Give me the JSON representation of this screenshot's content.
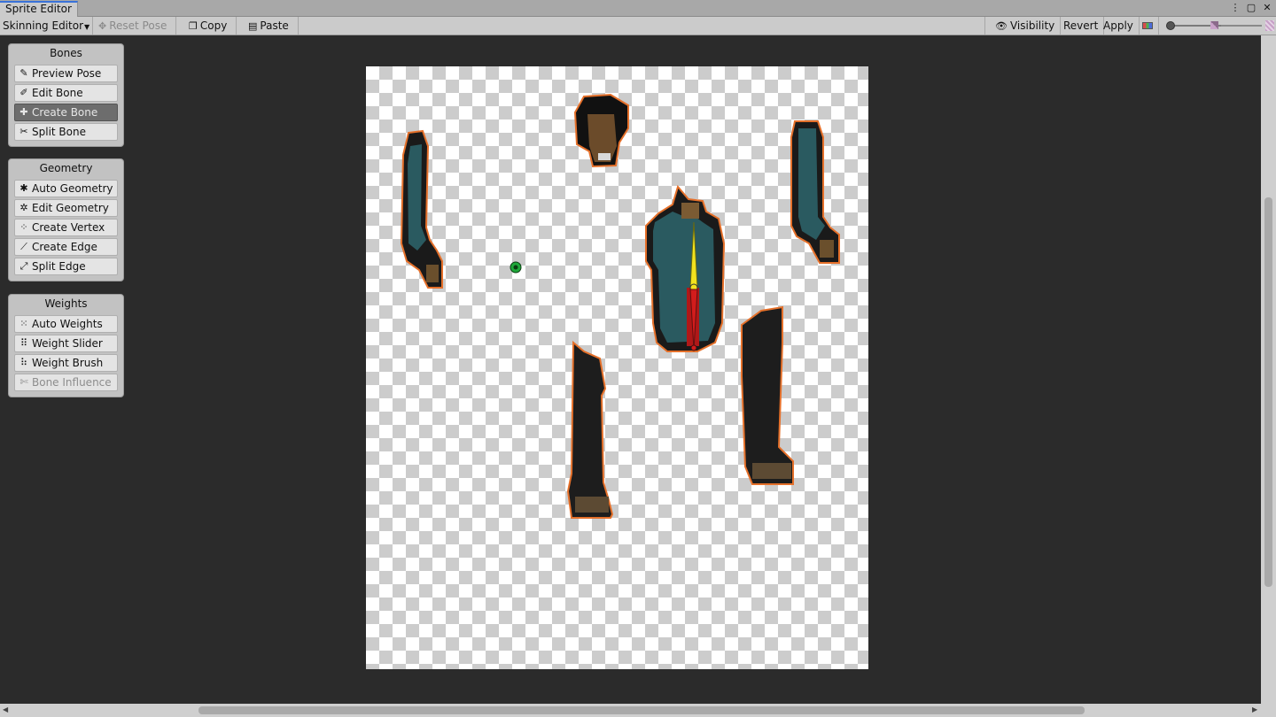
{
  "window": {
    "tab_title": "Sprite Editor"
  },
  "toolbar": {
    "mode_label": "Skinning Editor",
    "reset_pose_label": "Reset Pose",
    "copy_label": "Copy",
    "paste_label": "Paste",
    "visibility_label": "Visibility",
    "revert_label": "Revert",
    "apply_label": "Apply"
  },
  "panels": {
    "bones": {
      "title": "Bones",
      "buttons": [
        "Preview Pose",
        "Edit Bone",
        "Create Bone",
        "Split Bone"
      ],
      "active": "Create Bone"
    },
    "geometry": {
      "title": "Geometry",
      "buttons": [
        "Auto Geometry",
        "Edit Geometry",
        "Create Vertex",
        "Create Edge",
        "Split Edge"
      ]
    },
    "weights": {
      "title": "Weights",
      "buttons": [
        "Auto Weights",
        "Weight Slider",
        "Weight Brush",
        "Bone Influence"
      ],
      "disabled": "Bone Influence"
    }
  },
  "colors": {
    "outline": "#e5702a",
    "jacket": "#2a5a60",
    "pants": "#1d1d1d",
    "bone_selected": "#f2e21e",
    "bone": "#d21c1c",
    "pivot": "#1fa83a"
  },
  "icons": {
    "dropdown": "chevron-down-icon",
    "reset_pose": "bone-pose-icon",
    "copy": "copy-icon",
    "paste": "paste-icon",
    "visibility": "eye-icon"
  }
}
